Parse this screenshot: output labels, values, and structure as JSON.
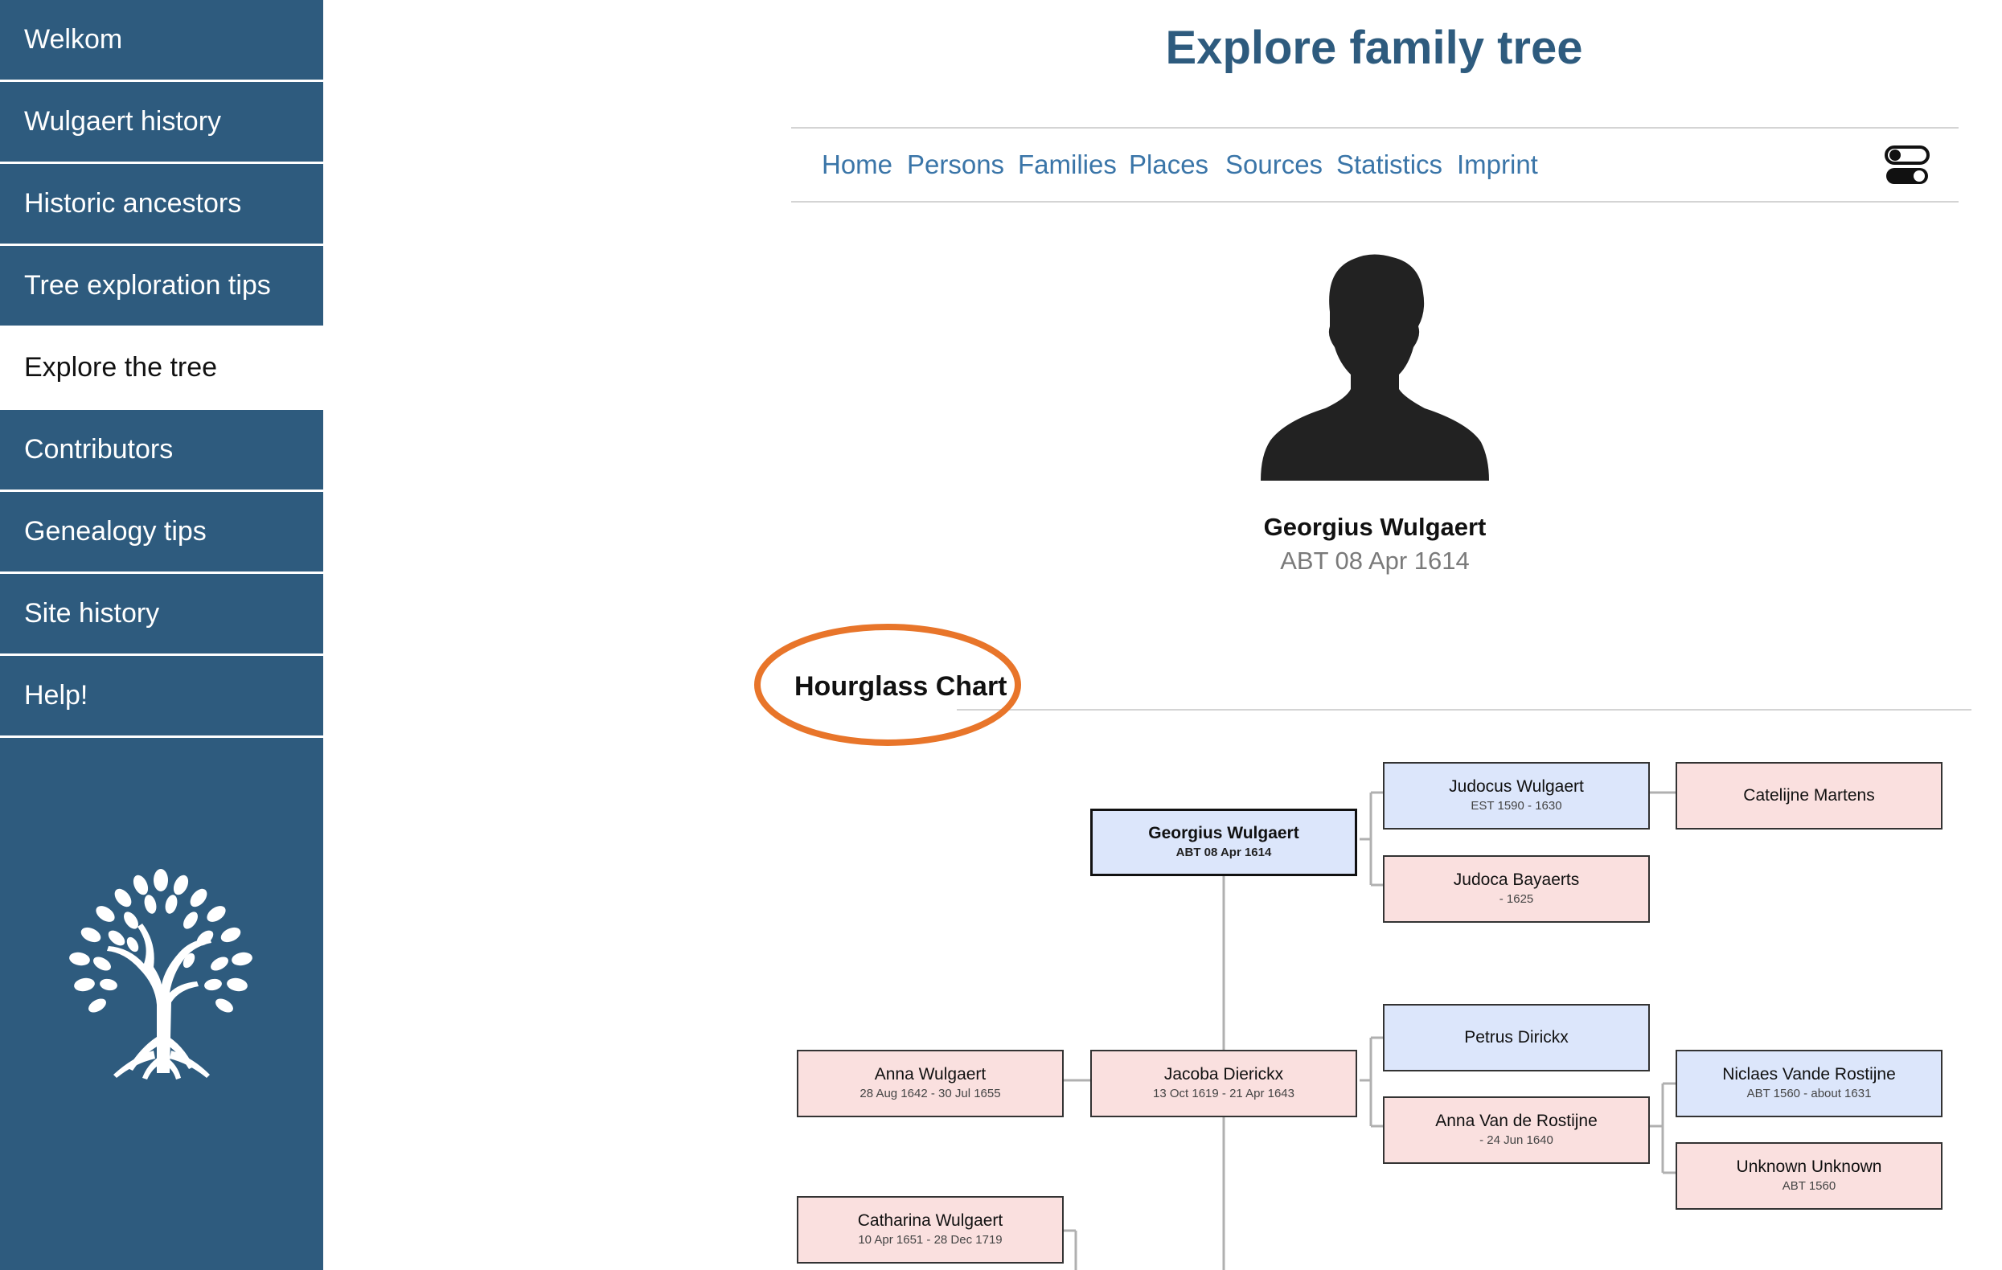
{
  "sidebar": {
    "items": [
      {
        "label": "Welkom"
      },
      {
        "label": "Wulgaert history"
      },
      {
        "label": "Historic ancestors"
      },
      {
        "label": "Tree exploration tips"
      },
      {
        "label": "Explore the tree",
        "active": true
      },
      {
        "label": "Contributors"
      },
      {
        "label": "Genealogy tips"
      },
      {
        "label": "Site history"
      },
      {
        "label": "Help!"
      }
    ],
    "logo_icon": "tree-logo-icon"
  },
  "header": {
    "title": "Explore family tree"
  },
  "topnav": {
    "links": [
      "Home",
      "Persons",
      "Families",
      "Places",
      "Sources",
      "Statistics",
      "Imprint"
    ],
    "toggle_icon": "theme-toggle-icon"
  },
  "person": {
    "name": "Georgius Wulgaert",
    "date": "ABT 08 Apr 1614",
    "portrait_icon": "person-silhouette-icon"
  },
  "chart": {
    "heading": "Hourglass Chart",
    "nodes": {
      "root": {
        "name": "Georgius Wulgaert",
        "dates": "ABT 08 Apr 1614",
        "sex": "male"
      },
      "father": {
        "name": "Judocus Wulgaert",
        "dates": "EST 1590 - 1630",
        "sex": "male"
      },
      "mother": {
        "name": "Judoca Bayaerts",
        "dates": "- 1625",
        "sex": "female"
      },
      "paternal_partner": {
        "name": "Catelijne Martens",
        "dates": "",
        "sex": "female"
      },
      "spouse": {
        "name": "Jacoba Dierickx",
        "dates": "13 Oct 1619 - 21 Apr 1643",
        "sex": "female"
      },
      "spouse_father": {
        "name": "Petrus Dirickx",
        "dates": "",
        "sex": "male"
      },
      "spouse_mother": {
        "name": "Anna Van de Rostijne",
        "dates": "- 24 Jun 1640",
        "sex": "female"
      },
      "spouse_grandfather": {
        "name": "Niclaes Vande Rostijne",
        "dates": "ABT 1560 - about 1631",
        "sex": "male"
      },
      "spouse_grandmother": {
        "name": "Unknown Unknown",
        "dates": "ABT 1560",
        "sex": "female"
      },
      "child1": {
        "name": "Anna Wulgaert",
        "dates": "28 Aug 1642 - 30 Jul 1655",
        "sex": "female"
      },
      "child2": {
        "name": "Catharina Wulgaert",
        "dates": "10 Apr 1651 - 28 Dec 1719",
        "sex": "female"
      }
    }
  },
  "colors": {
    "sidebar_bg": "#2e5b7e",
    "title": "#2e5b7e",
    "link": "#3a75a8",
    "male_box": "#dce6fb",
    "female_box": "#fae0df",
    "highlight": "#e8752a"
  }
}
